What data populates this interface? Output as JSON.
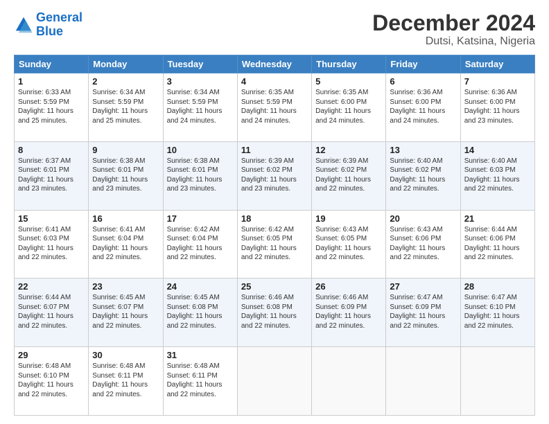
{
  "logo": {
    "line1": "General",
    "line2": "Blue"
  },
  "title": "December 2024",
  "location": "Dutsi, Katsina, Nigeria",
  "days_header": [
    "Sunday",
    "Monday",
    "Tuesday",
    "Wednesday",
    "Thursday",
    "Friday",
    "Saturday"
  ],
  "weeks": [
    [
      {
        "day": "1",
        "sunrise": "6:33 AM",
        "sunset": "5:59 PM",
        "daylight": "11 hours and 25 minutes."
      },
      {
        "day": "2",
        "sunrise": "6:34 AM",
        "sunset": "5:59 PM",
        "daylight": "11 hours and 25 minutes."
      },
      {
        "day": "3",
        "sunrise": "6:34 AM",
        "sunset": "5:59 PM",
        "daylight": "11 hours and 24 minutes."
      },
      {
        "day": "4",
        "sunrise": "6:35 AM",
        "sunset": "5:59 PM",
        "daylight": "11 hours and 24 minutes."
      },
      {
        "day": "5",
        "sunrise": "6:35 AM",
        "sunset": "6:00 PM",
        "daylight": "11 hours and 24 minutes."
      },
      {
        "day": "6",
        "sunrise": "6:36 AM",
        "sunset": "6:00 PM",
        "daylight": "11 hours and 24 minutes."
      },
      {
        "day": "7",
        "sunrise": "6:36 AM",
        "sunset": "6:00 PM",
        "daylight": "11 hours and 23 minutes."
      }
    ],
    [
      {
        "day": "8",
        "sunrise": "6:37 AM",
        "sunset": "6:01 PM",
        "daylight": "11 hours and 23 minutes."
      },
      {
        "day": "9",
        "sunrise": "6:38 AM",
        "sunset": "6:01 PM",
        "daylight": "11 hours and 23 minutes."
      },
      {
        "day": "10",
        "sunrise": "6:38 AM",
        "sunset": "6:01 PM",
        "daylight": "11 hours and 23 minutes."
      },
      {
        "day": "11",
        "sunrise": "6:39 AM",
        "sunset": "6:02 PM",
        "daylight": "11 hours and 23 minutes."
      },
      {
        "day": "12",
        "sunrise": "6:39 AM",
        "sunset": "6:02 PM",
        "daylight": "11 hours and 22 minutes."
      },
      {
        "day": "13",
        "sunrise": "6:40 AM",
        "sunset": "6:02 PM",
        "daylight": "11 hours and 22 minutes."
      },
      {
        "day": "14",
        "sunrise": "6:40 AM",
        "sunset": "6:03 PM",
        "daylight": "11 hours and 22 minutes."
      }
    ],
    [
      {
        "day": "15",
        "sunrise": "6:41 AM",
        "sunset": "6:03 PM",
        "daylight": "11 hours and 22 minutes."
      },
      {
        "day": "16",
        "sunrise": "6:41 AM",
        "sunset": "6:04 PM",
        "daylight": "11 hours and 22 minutes."
      },
      {
        "day": "17",
        "sunrise": "6:42 AM",
        "sunset": "6:04 PM",
        "daylight": "11 hours and 22 minutes."
      },
      {
        "day": "18",
        "sunrise": "6:42 AM",
        "sunset": "6:05 PM",
        "daylight": "11 hours and 22 minutes."
      },
      {
        "day": "19",
        "sunrise": "6:43 AM",
        "sunset": "6:05 PM",
        "daylight": "11 hours and 22 minutes."
      },
      {
        "day": "20",
        "sunrise": "6:43 AM",
        "sunset": "6:06 PM",
        "daylight": "11 hours and 22 minutes."
      },
      {
        "day": "21",
        "sunrise": "6:44 AM",
        "sunset": "6:06 PM",
        "daylight": "11 hours and 22 minutes."
      }
    ],
    [
      {
        "day": "22",
        "sunrise": "6:44 AM",
        "sunset": "6:07 PM",
        "daylight": "11 hours and 22 minutes."
      },
      {
        "day": "23",
        "sunrise": "6:45 AM",
        "sunset": "6:07 PM",
        "daylight": "11 hours and 22 minutes."
      },
      {
        "day": "24",
        "sunrise": "6:45 AM",
        "sunset": "6:08 PM",
        "daylight": "11 hours and 22 minutes."
      },
      {
        "day": "25",
        "sunrise": "6:46 AM",
        "sunset": "6:08 PM",
        "daylight": "11 hours and 22 minutes."
      },
      {
        "day": "26",
        "sunrise": "6:46 AM",
        "sunset": "6:09 PM",
        "daylight": "11 hours and 22 minutes."
      },
      {
        "day": "27",
        "sunrise": "6:47 AM",
        "sunset": "6:09 PM",
        "daylight": "11 hours and 22 minutes."
      },
      {
        "day": "28",
        "sunrise": "6:47 AM",
        "sunset": "6:10 PM",
        "daylight": "11 hours and 22 minutes."
      }
    ],
    [
      {
        "day": "29",
        "sunrise": "6:48 AM",
        "sunset": "6:10 PM",
        "daylight": "11 hours and 22 minutes."
      },
      {
        "day": "30",
        "sunrise": "6:48 AM",
        "sunset": "6:11 PM",
        "daylight": "11 hours and 22 minutes."
      },
      {
        "day": "31",
        "sunrise": "6:48 AM",
        "sunset": "6:11 PM",
        "daylight": "11 hours and 22 minutes."
      },
      null,
      null,
      null,
      null
    ]
  ]
}
